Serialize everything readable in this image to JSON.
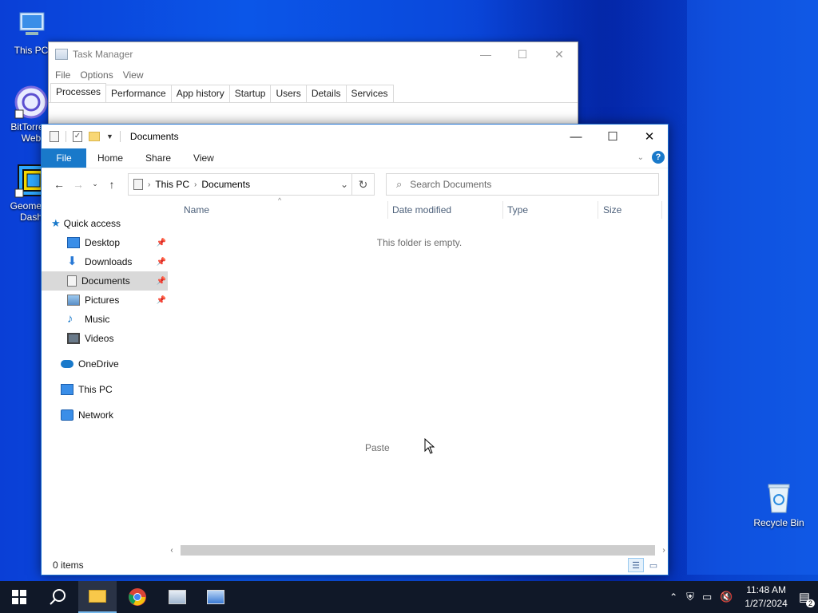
{
  "desktop": {
    "icons": [
      {
        "label": "This PC"
      },
      {
        "label": "BitTorrent Web"
      },
      {
        "label": "Geometry Dash"
      },
      {
        "label": "Recycle Bin"
      }
    ]
  },
  "taskmanager": {
    "title": "Task Manager",
    "menu": [
      "File",
      "Options",
      "View"
    ],
    "tabs": [
      "Processes",
      "Performance",
      "App history",
      "Startup",
      "Users",
      "Details",
      "Services"
    ],
    "active_tab": "Processes"
  },
  "explorer": {
    "title": "Documents",
    "ribbon": {
      "file": "File",
      "tabs": [
        "Home",
        "Share",
        "View"
      ]
    },
    "address": {
      "segments": [
        "This PC",
        "Documents"
      ]
    },
    "search_placeholder": "Search Documents",
    "nav": {
      "quick_access": "Quick access",
      "items": [
        {
          "label": "Desktop",
          "icon": "desktop-icon",
          "pinned": true
        },
        {
          "label": "Downloads",
          "icon": "download-icon",
          "pinned": true
        },
        {
          "label": "Documents",
          "icon": "documents-icon",
          "pinned": true,
          "selected": true
        },
        {
          "label": "Pictures",
          "icon": "pictures-icon",
          "pinned": true
        },
        {
          "label": "Music",
          "icon": "music-icon",
          "pinned": false
        },
        {
          "label": "Videos",
          "icon": "videos-icon",
          "pinned": false
        }
      ],
      "onedrive": "OneDrive",
      "thispc": "This PC",
      "network": "Network"
    },
    "columns": [
      "Name",
      "Date modified",
      "Type",
      "Size"
    ],
    "empty_text": "This folder is empty.",
    "context_hint": "Paste",
    "status": "0 items"
  },
  "taskbar": {
    "time": "11:48 AM",
    "date": "1/27/2024",
    "notification_count": "2"
  },
  "colors": {
    "accent": "#1979ca",
    "taskbar": "#101828"
  }
}
